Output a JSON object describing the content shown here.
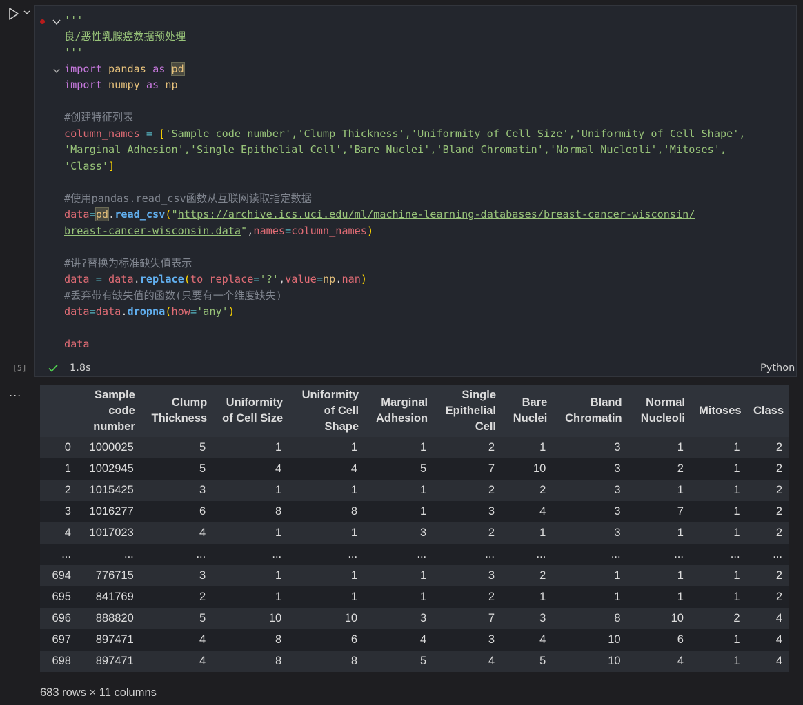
{
  "cell": {
    "exec_count": "[5]",
    "duration": "1.8s",
    "language": "Python",
    "code": {
      "l1": "'''",
      "l2": "良/恶性乳腺癌数据预处理",
      "l3": "'''",
      "import_kw": "import",
      "pandas": "pandas",
      "as_kw": "as",
      "pd": "pd",
      "numpy": "numpy",
      "np": "np",
      "comment1": "#创建特征列表",
      "column_names": "column_names",
      "eq": " = ",
      "list_line1": "'Sample code number','Clump Thickness','Uniformity of Cell Size','Uniformity of Cell Shape',",
      "list_line2": "'Marginal Adhesion','Single Epithelial Cell','Bare Nuclei','Bland Chromatin','Normal Nucleoli','Mitoses',",
      "list_line3": "'Class'",
      "comment2": "#使用pandas.read_csv函数从互联网读取指定数据",
      "data": "data",
      "read_csv": "read_csv",
      "url1": "https://archive.ics.uci.edu/ml/machine-learning-databases/breast-cancer-wisconsin/",
      "url2": "breast-cancer-wisconsin.data",
      "names_kw": "names",
      "comment3": "#讲?替换为标准缺失值表示",
      "replace": "replace",
      "to_replace": "to_replace",
      "qmark": "'?'",
      "value_kw": "value",
      "nan": "nan",
      "comment4": "#丢弃带有缺失值的函数(只要有一个维度缺失)",
      "dropna": "dropna",
      "how_kw": "how",
      "any": "'any'"
    }
  },
  "output": {
    "more_label": "...",
    "columns": [
      "",
      "Sample code number",
      "Clump Thickness",
      "Uniformity of Cell Size",
      "Uniformity of Cell Shape",
      "Marginal Adhesion",
      "Single Epithelial Cell",
      "Bare Nuclei",
      "Bland Chromatin",
      "Normal Nucleoli",
      "Mitoses",
      "Class"
    ],
    "rows": [
      [
        "0",
        "1000025",
        "5",
        "1",
        "1",
        "1",
        "2",
        "1",
        "3",
        "1",
        "1",
        "2"
      ],
      [
        "1",
        "1002945",
        "5",
        "4",
        "4",
        "5",
        "7",
        "10",
        "3",
        "2",
        "1",
        "2"
      ],
      [
        "2",
        "1015425",
        "3",
        "1",
        "1",
        "1",
        "2",
        "2",
        "3",
        "1",
        "1",
        "2"
      ],
      [
        "3",
        "1016277",
        "6",
        "8",
        "8",
        "1",
        "3",
        "4",
        "3",
        "7",
        "1",
        "2"
      ],
      [
        "4",
        "1017023",
        "4",
        "1",
        "1",
        "3",
        "2",
        "1",
        "3",
        "1",
        "1",
        "2"
      ],
      [
        "...",
        "...",
        "...",
        "...",
        "...",
        "...",
        "...",
        "...",
        "...",
        "...",
        "...",
        "..."
      ],
      [
        "694",
        "776715",
        "3",
        "1",
        "1",
        "1",
        "3",
        "2",
        "1",
        "1",
        "1",
        "2"
      ],
      [
        "695",
        "841769",
        "2",
        "1",
        "1",
        "1",
        "2",
        "1",
        "1",
        "1",
        "1",
        "2"
      ],
      [
        "696",
        "888820",
        "5",
        "10",
        "10",
        "3",
        "7",
        "3",
        "8",
        "10",
        "2",
        "4"
      ],
      [
        "697",
        "897471",
        "4",
        "8",
        "6",
        "4",
        "3",
        "4",
        "10",
        "6",
        "1",
        "4"
      ],
      [
        "698",
        "897471",
        "4",
        "8",
        "8",
        "5",
        "4",
        "5",
        "10",
        "4",
        "1",
        "4"
      ]
    ],
    "shape_text": "683 rows × 11 columns"
  }
}
